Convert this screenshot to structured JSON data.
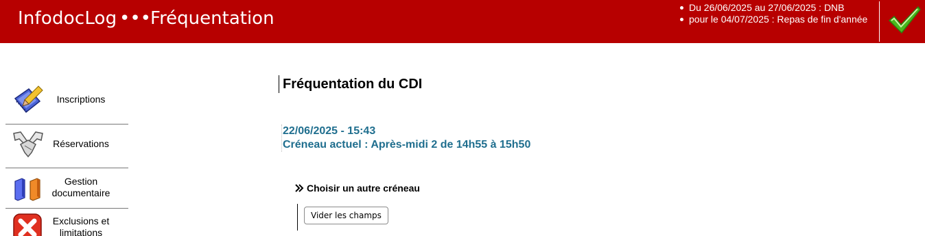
{
  "header": {
    "app_title": "InfodocLog",
    "separator": "•••",
    "page_name": "Fréquentation",
    "notices": [
      "Du 26/06/2025 au 27/06/2025 : DNB",
      "pour le 04/07/2025 : Repas de fin d'année"
    ],
    "confirm_icon": "green-checkmark-icon",
    "background_color": "#b70000"
  },
  "sidebar": {
    "items": [
      {
        "label": "Inscriptions",
        "icon": "pen-notebook-icon"
      },
      {
        "label": "Réservations",
        "icon": "handshake-icon"
      },
      {
        "label": "Gestion documentaire",
        "icon": "books-icon"
      },
      {
        "label": "Exclusions et limitations",
        "icon": "red-x-icon"
      }
    ]
  },
  "main": {
    "title": "Fréquentation du CDI",
    "datetime": "22/06/2025 - 15:43",
    "current_slot": "Créneau actuel : Après-midi 2 de 14h55 à 15h50",
    "choose_other_slot": "Choisir un autre créneau",
    "clear_fields_button": "Vider les champs",
    "accent_color": "#1f6e8e"
  }
}
